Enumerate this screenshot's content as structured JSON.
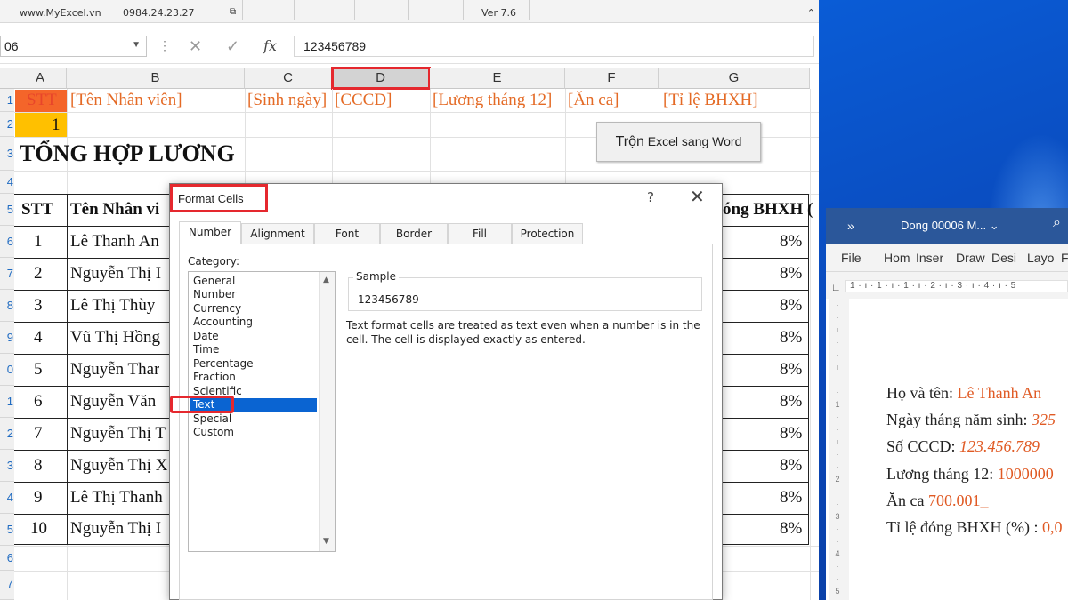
{
  "excel": {
    "ribbon": {
      "site": "www.MyExcel.vn",
      "phone": "0984.24.23.27",
      "version": "Ver 7.6"
    },
    "name_box": "06",
    "formula_value": "123456789",
    "columns": [
      "A",
      "B",
      "C",
      "D",
      "E",
      "F",
      "G"
    ],
    "row_numbers": [
      "1",
      "2",
      "3",
      "4",
      "5",
      "6",
      "7",
      "8",
      "9",
      "0",
      "1",
      "2",
      "3",
      "4",
      "5",
      "6",
      "7"
    ],
    "field_placeholders": [
      "STT",
      "[Tên Nhân viên]",
      "[Sinh ngày]",
      "[CCCD]",
      "[Lương tháng 12]",
      "[Ăn ca]",
      "[Tỉ lệ BHXH]"
    ],
    "row2_value": "1",
    "sheet_title": "TỔNG HỢP LƯƠNG",
    "table_headers": {
      "stt": "STT",
      "name": "Tên Nhân vi",
      "bhxh": "óng BHXH ("
    },
    "rows": [
      {
        "stt": "1",
        "name": "Lê Thanh An",
        "pct": "8%"
      },
      {
        "stt": "2",
        "name": "Nguyễn Thị I",
        "pct": "8%"
      },
      {
        "stt": "3",
        "name": "Lê Thị Thùy",
        "pct": "8%"
      },
      {
        "stt": "4",
        "name": "Vũ Thị Hồng",
        "pct": "8%"
      },
      {
        "stt": "5",
        "name": "Nguyễn Thar",
        "pct": "8%"
      },
      {
        "stt": "6",
        "name": "Nguyễn Văn",
        "pct": "8%"
      },
      {
        "stt": "7",
        "name": "Nguyễn Thị T",
        "pct": "8%"
      },
      {
        "stt": "8",
        "name": "Nguyễn Thị X",
        "pct": "8%"
      },
      {
        "stt": "9",
        "name": "Lê Thị Thanh",
        "pct": "8%"
      },
      {
        "stt": "10",
        "name": "Nguyễn Thị I",
        "pct": "8%"
      }
    ],
    "merge_button": {
      "prefix": "Trộn",
      "rest": " Excel sang Word"
    }
  },
  "dialog": {
    "title": "Format Cells",
    "help": "?",
    "close": "✕",
    "tabs": [
      "Number",
      "Alignment",
      "Font",
      "Border",
      "Fill",
      "Protection"
    ],
    "active_tab": "Number",
    "category_label": "Category:",
    "categories": [
      "General",
      "Number",
      "Currency",
      "Accounting",
      "Date",
      "Time",
      "Percentage",
      "Fraction",
      "Scientific",
      "Text",
      "Special",
      "Custom"
    ],
    "selected_category": "Text",
    "sample_label": "Sample",
    "sample_value": "123456789",
    "description": "Text format cells are treated as text even when a number is in the cell. The cell is displayed exactly as entered."
  },
  "word": {
    "title_chevron": "»",
    "doc_title": "Dong 00006 M... ⌄",
    "menu": [
      "File",
      "Hom",
      "Inser",
      "Draw",
      "Desi",
      "Layo",
      "F"
    ],
    "ruler": "1 · ı · 1 · ı · 1 · ı · 2 · ı · 3 · ı · 4 · ı · 5",
    "lines": [
      {
        "label": "Họ và tên: ",
        "value": "Lê Thanh An",
        "italic": false
      },
      {
        "label": "Ngày tháng năm sinh: ",
        "value": "325",
        "italic": true
      },
      {
        "label": "Số CCCD: ",
        "value": "123.456.789",
        "italic": true
      },
      {
        "label": "Lương tháng 12: ",
        "value": "1000000",
        "italic": false
      },
      {
        "label": "Ăn ca ",
        "value": "700.001_",
        "italic": false
      },
      {
        "label": "Tỉ lệ đóng BHXH (%) : ",
        "value": "0,0",
        "italic": false
      }
    ]
  },
  "colors": {
    "accent_red": "#e5282e",
    "orange_text": "#e46a25",
    "selection_blue": "#0a64d2",
    "word_blue": "#2b579a",
    "a1_fill": "#f4652a",
    "a2_fill": "#ffc000"
  }
}
